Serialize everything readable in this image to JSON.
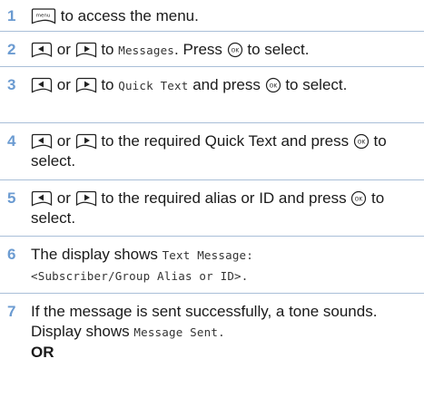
{
  "steps": [
    {
      "number": "1",
      "text_after_menu_key": " to access the menu."
    },
    {
      "number": "2",
      "or": "or",
      "to": " to ",
      "menu_item": "Messages",
      "text_press": ". Press ",
      "text_select": " to select."
    },
    {
      "number": "3",
      "or": "or",
      "to": " to ",
      "menu_item": "Quick Text",
      "text_press": " and press ",
      "text_select": " to select."
    },
    {
      "number": "4",
      "or": "or",
      "text_mid": " to the required Quick Text and press ",
      "text_select": " to select."
    },
    {
      "number": "5",
      "or": "or",
      "text_mid": " to the required alias or ID and press ",
      "text_select": " to select."
    },
    {
      "number": "6",
      "text_pre": "The display shows ",
      "display_line1": "Text Message:",
      "display_line2": "<Subscriber/Group Alias or ID>."
    },
    {
      "number": "7",
      "text_pre": "If the message is sent successfully, a tone sounds. Display shows ",
      "display_text": "Message Sent.",
      "or_label": "OR"
    }
  ],
  "icons": {
    "menu_key_label": "menu",
    "ok_key_label": "OK",
    "left_key": "left-arrow-key-icon",
    "right_key": "right-arrow-key-icon"
  }
}
